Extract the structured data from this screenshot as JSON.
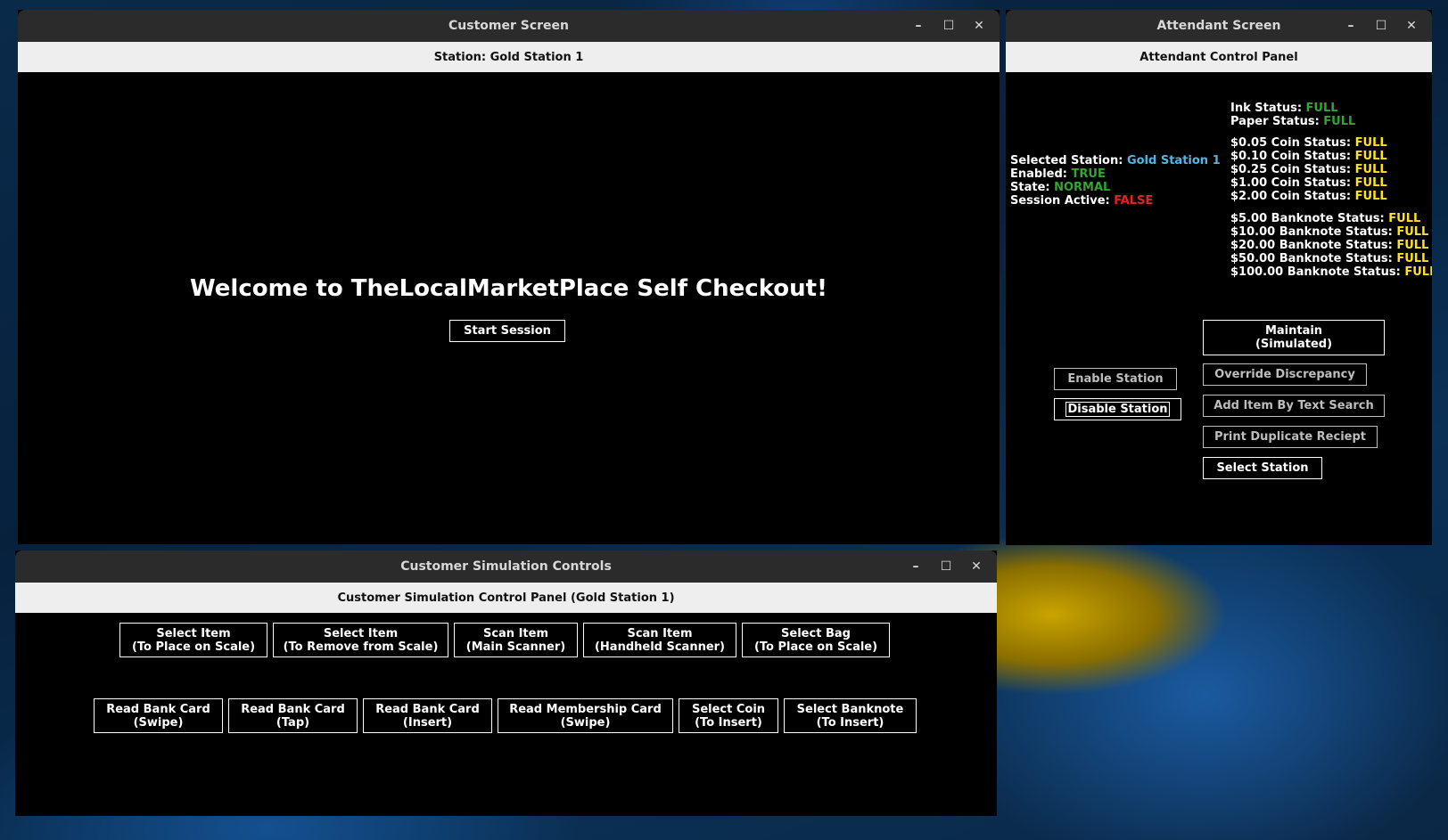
{
  "customer_window": {
    "title": "Customer Screen",
    "station_label": "Station: Gold Station 1",
    "welcome": "Welcome to TheLocalMarketPlace Self Checkout!",
    "start_session": "Start Session"
  },
  "attendant_window": {
    "title": "Attendant Screen",
    "panel_title": "Attendant Control Panel",
    "station_info": {
      "selected_label": "Selected Station: ",
      "selected_value": "Gold Station 1",
      "enabled_label": "Enabled: ",
      "enabled_value": "TRUE",
      "state_label": "State: ",
      "state_value": "NORMAL",
      "session_label": "Session Active: ",
      "session_value": "FALSE"
    },
    "printer_status": [
      {
        "label": "Ink Status: ",
        "value": "FULL"
      },
      {
        "label": "Paper Status: ",
        "value": "FULL"
      }
    ],
    "coin_status": [
      {
        "label": "$0.05 Coin Status: ",
        "value": "FULL"
      },
      {
        "label": "$0.10 Coin Status: ",
        "value": "FULL"
      },
      {
        "label": "$0.25 Coin Status: ",
        "value": "FULL"
      },
      {
        "label": "$1.00 Coin Status: ",
        "value": "FULL"
      },
      {
        "label": "$2.00 Coin Status: ",
        "value": "FULL"
      }
    ],
    "banknote_status": [
      {
        "label": "$5.00 Banknote Status: ",
        "value": "FULL"
      },
      {
        "label": "$10.00 Banknote Status: ",
        "value": "FULL"
      },
      {
        "label": "$20.00 Banknote Status: ",
        "value": "FULL"
      },
      {
        "label": "$50.00 Banknote Status: ",
        "value": "FULL"
      },
      {
        "label": "$100.00 Banknote Status: ",
        "value": "FULL"
      }
    ],
    "buttons": {
      "maintain_line1": "Maintain",
      "maintain_line2": "(Simulated)",
      "enable_station": "Enable Station",
      "disable_station": "Disable Station",
      "override_discrepancy": "Override Discrepancy",
      "add_item_text_search": "Add Item By Text Search",
      "print_duplicate": "Print Duplicate Reciept",
      "select_station": "Select Station"
    }
  },
  "simulation_window": {
    "title": "Customer Simulation Controls",
    "panel_title": "Customer Simulation Control Panel (Gold Station 1)",
    "row1": [
      {
        "line1": "Select Item",
        "line2": "(To Place on Scale)"
      },
      {
        "line1": "Select Item",
        "line2": "(To Remove from Scale)"
      },
      {
        "line1": "Scan Item",
        "line2": "(Main Scanner)"
      },
      {
        "line1": "Scan Item",
        "line2": "(Handheld Scanner)"
      },
      {
        "line1": "Select Bag",
        "line2": "(To Place on Scale)"
      }
    ],
    "row2": [
      {
        "line1": "Read Bank Card",
        "line2": "(Swipe)"
      },
      {
        "line1": "Read Bank Card",
        "line2": "(Tap)"
      },
      {
        "line1": "Read Bank Card",
        "line2": "(Insert)"
      },
      {
        "line1": "Read Membership Card",
        "line2": "(Swipe)"
      },
      {
        "line1": "Select Coin",
        "line2": "(To Insert)"
      },
      {
        "line1": "Select Banknote",
        "line2": "(To Insert)"
      }
    ]
  },
  "window_controls": {
    "minimize": "–",
    "maximize": "☐",
    "close": "✕"
  },
  "colors": {
    "ok_green": "#2ea82e",
    "false_red": "#e52222",
    "full_yellow": "#ffe21a",
    "station_cyan": "#4fb6e6"
  }
}
